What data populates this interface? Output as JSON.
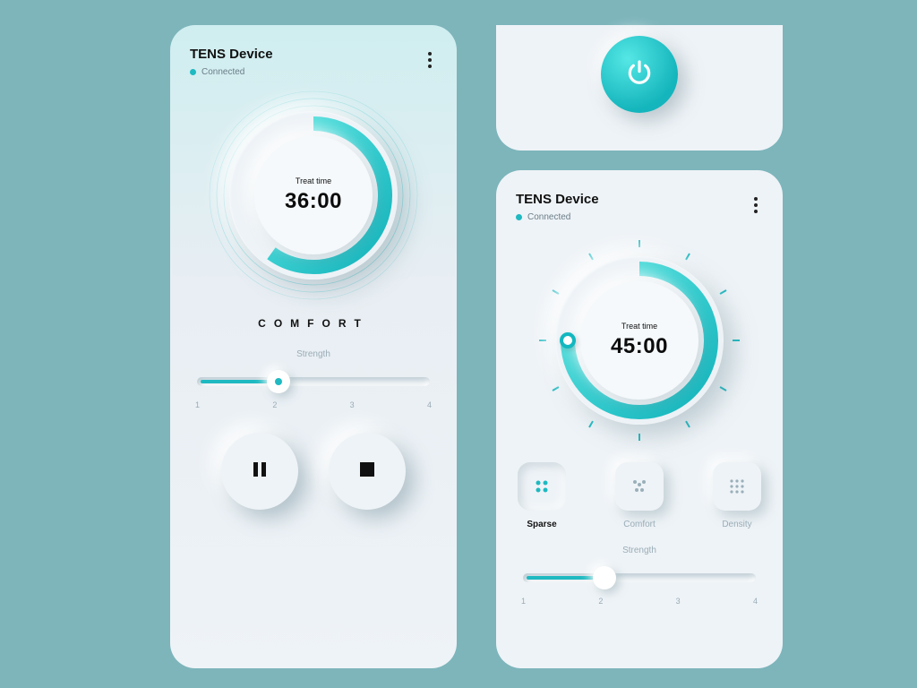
{
  "colors": {
    "accent": "#1fb9c1",
    "bg": "#7db5bb",
    "card": "#eef3f7",
    "card_top": "#cfeef0",
    "text": "#111",
    "muted": "#9aacb6"
  },
  "header": {
    "title": "TENS Device",
    "status": "Connected"
  },
  "left": {
    "treat_label": "Treat time",
    "treat_time": "36:00",
    "progress_pct": 60,
    "mode": "COMFORT",
    "strength_label": "Strength",
    "strength_value": 2,
    "strength_scale": [
      "1",
      "2",
      "3",
      "4"
    ]
  },
  "right": {
    "treat_label": "Treat time",
    "treat_time": "45:00",
    "progress_pct": 75,
    "modes": [
      {
        "key": "sparse",
        "label": "Sparse",
        "active": true
      },
      {
        "key": "comfort",
        "label": "Comfort",
        "active": false
      },
      {
        "key": "density",
        "label": "Density",
        "active": false
      }
    ],
    "strength_label": "Strength",
    "strength_value": 2,
    "strength_scale": [
      "1",
      "2",
      "3",
      "4"
    ]
  },
  "power": {
    "label": "Power"
  }
}
